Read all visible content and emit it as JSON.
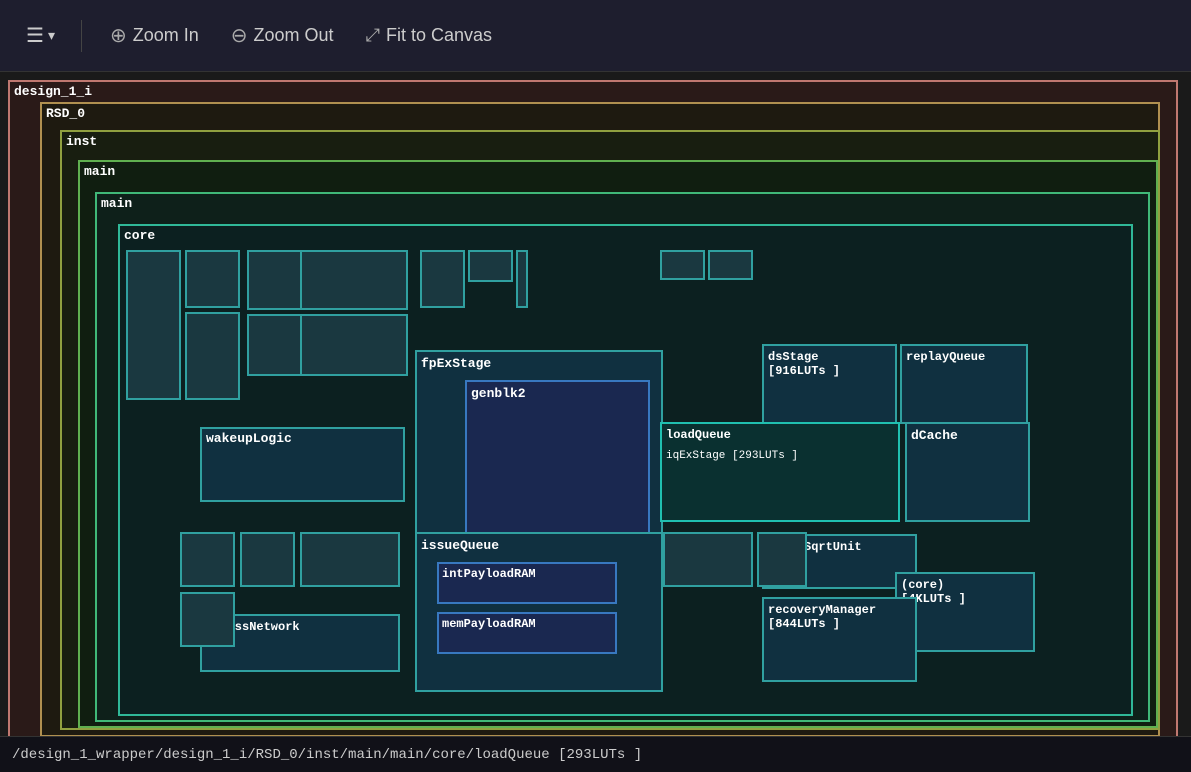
{
  "toolbar": {
    "menu_icon": "☰",
    "menu_dropdown": "▾",
    "zoom_in_icon": "⊕",
    "zoom_in_label": "Zoom In",
    "zoom_out_icon": "⊖",
    "zoom_out_label": "Zoom Out",
    "fit_icon": "⤢",
    "fit_label": "Fit to Canvas"
  },
  "hierarchy": {
    "design1i": "design_1_i",
    "rsd0": "RSD_0",
    "inst": "inst",
    "main_outer": "main",
    "main_inner": "main",
    "core": "core",
    "wakeupLogic": "wakeupLogic",
    "fpExStage": "fpExStage",
    "genblk2": "genblk2",
    "dsStage": "dsStage\n[916LUTs ]",
    "replayQueue": "replayQueue",
    "loadQueue_label": "loadQueue",
    "iqExStage": "iqExStage [293LUTs ]",
    "dCache": "dCache",
    "issueQueue": "issueQueue",
    "intPayloadRAM": "intPayloadRAM",
    "memPayloadRAM": "memPayloadRAM",
    "fpDivSqrtUnit": "fpDivSqrtUnit",
    "core_luts": "(core)\n[4KLUTs ]",
    "bypassNetwork": "bypassNetwork",
    "recoveryManager": "recoveryManager\n[844LUTs ]"
  },
  "statusbar": {
    "path": "/design_1_wrapper/design_1_i/RSD_0/inst/main/main/core/loadQueue [293LUTs ]"
  }
}
